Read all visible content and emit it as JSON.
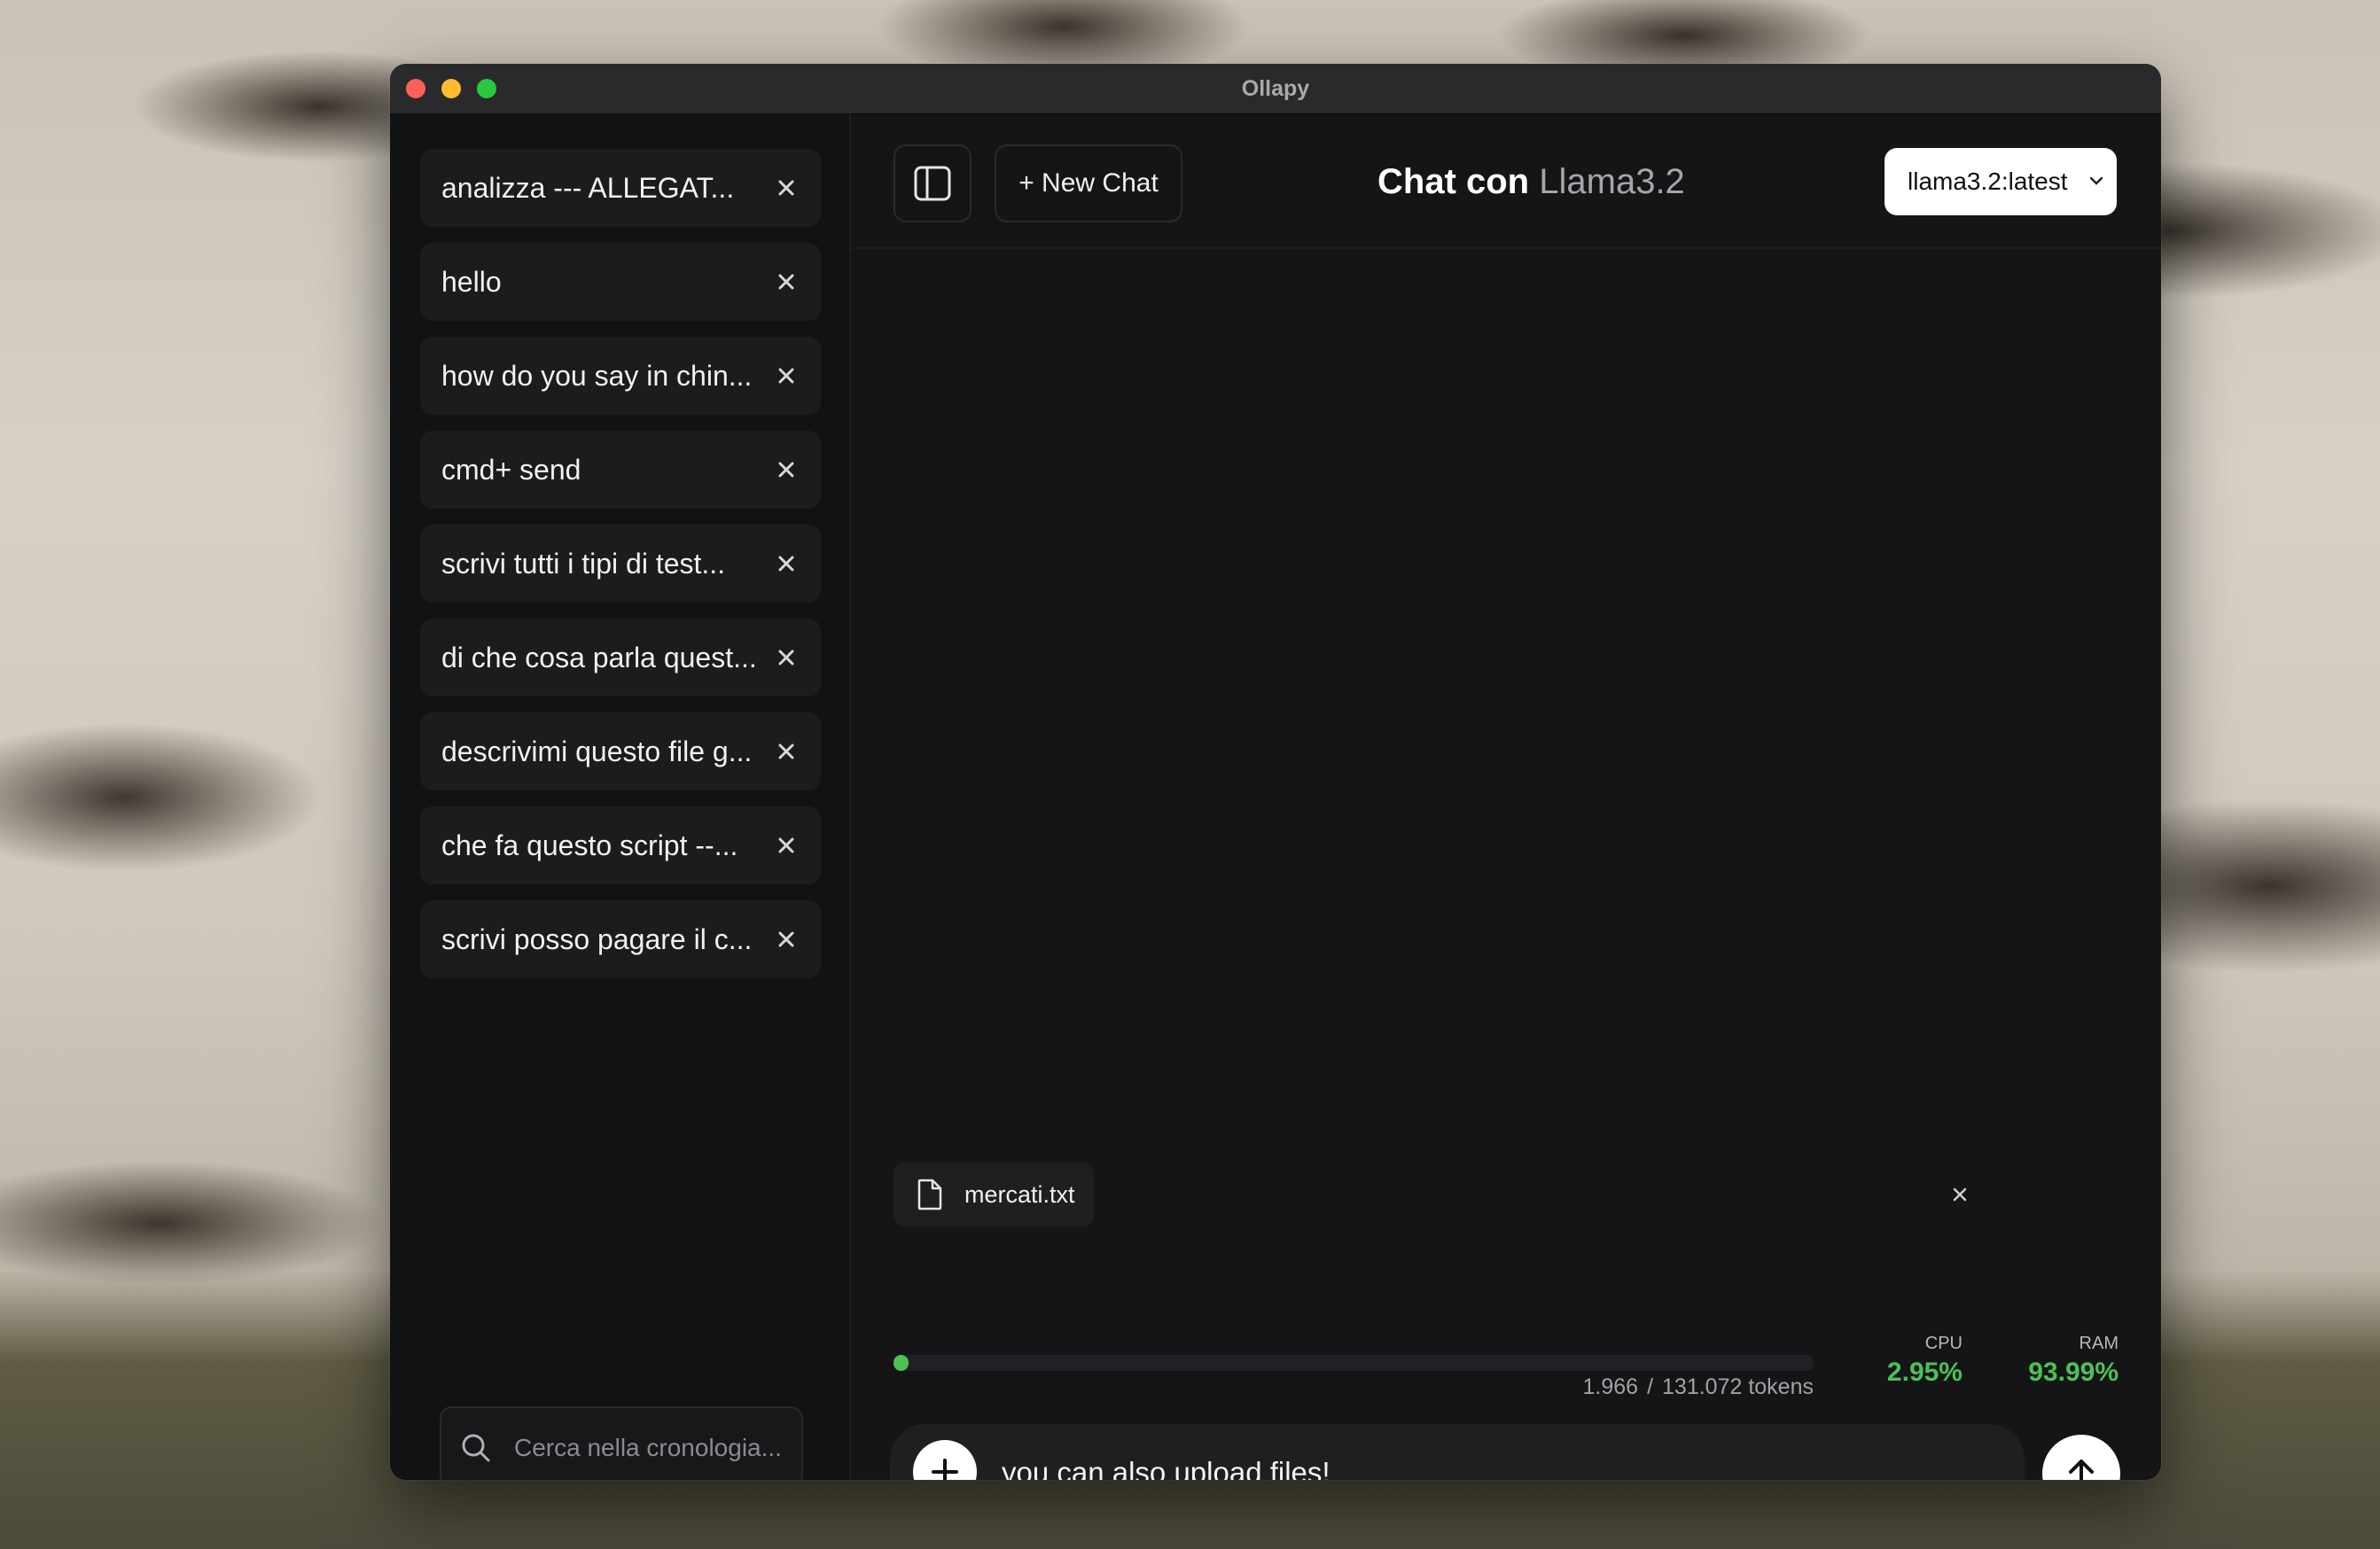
{
  "window": {
    "title": "Ollapy"
  },
  "sidebar": {
    "items": [
      {
        "label": "analizza --- ALLEGAT..."
      },
      {
        "label": "hello"
      },
      {
        "label": "how do you say in chin..."
      },
      {
        "label": "cmd+ send"
      },
      {
        "label": "scrivi tutti i tipi di test..."
      },
      {
        "label": "di che cosa parla quest..."
      },
      {
        "label": "descrivimi questo file g..."
      },
      {
        "label": "che fa questo script --..."
      },
      {
        "label": "scrivi posso pagare il c..."
      }
    ],
    "search": {
      "placeholder": "Cerca nella cronologia..."
    }
  },
  "header": {
    "new_chat_label": "+ New Chat",
    "title_prefix": "Chat con",
    "title_model": "Llama3.2",
    "model_select": {
      "value": "llama3.2:latest"
    }
  },
  "attachment": {
    "filename": "mercati.txt"
  },
  "context": {
    "used": "1.966",
    "total": "131.072 tokens",
    "fraction": 0.015
  },
  "stats": {
    "cpu_label": "CPU",
    "cpu_value": "2.95%",
    "ram_label": "RAM",
    "ram_value": "93.99%"
  },
  "composer": {
    "value": "you can also upload files!"
  },
  "colors": {
    "accent_green": "#4cc255",
    "background": "#151517"
  }
}
